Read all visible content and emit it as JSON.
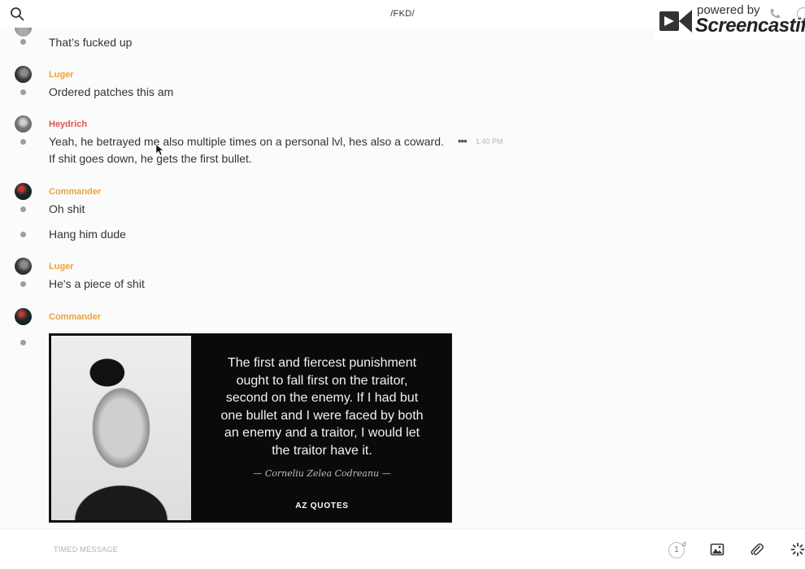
{
  "header": {
    "channel_title": "/FKD/",
    "search_icon": "search-icon"
  },
  "watermark": {
    "powered_by": "powered by",
    "brand": "Screencastify"
  },
  "messages": [
    {
      "text": "That’s fucked up"
    },
    {
      "sender": "Luger",
      "text": "Ordered patches this am"
    },
    {
      "sender": "Heydrich",
      "text": "Yeah, he betrayed me also multiple times on a personal lvl, hes also a coward.",
      "time": "1:40 PM",
      "text2": "If shit goes down, he gets the first bullet."
    },
    {
      "sender": "Commander",
      "text": "Oh shit",
      "text2": "Hang him dude"
    },
    {
      "sender": "Luger",
      "text": "He's a piece of shit"
    },
    {
      "sender": "Commander"
    }
  ],
  "quote_image": {
    "quote": "The first and fiercest punishment\nought to fall first on the traitor,\nsecond on the enemy. If I had but\none bullet and I were faced by both\nan enemy and a traitor, I would let\nthe traitor have it.",
    "author": "— Corneliu Zelea Codreanu —",
    "brand": "AZ QUOTES"
  },
  "more_label": "•••",
  "composer": {
    "placeholder": "TIMED MESSAGE",
    "timer_value": "1",
    "timer_unit": "d"
  },
  "colors": {
    "sender_orange": "#e8a33d",
    "sender_red": "#e05050",
    "bullet_gray": "#9e9e9e"
  }
}
